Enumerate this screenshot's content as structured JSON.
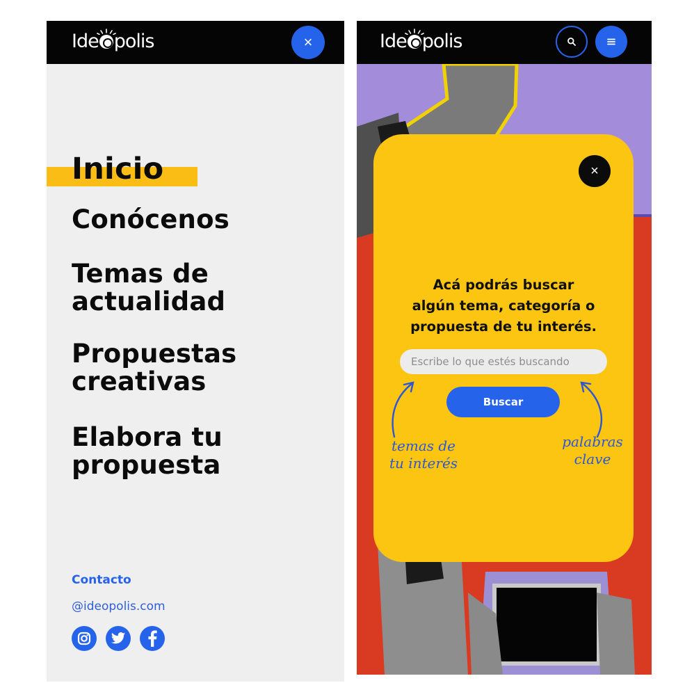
{
  "brand": {
    "logo_text_before": "Ide",
    "logo_text_after": "polis"
  },
  "colors": {
    "accent": "#2563eb",
    "highlight": "#f9bd15",
    "card": "#fbc512",
    "header": "#050505",
    "background_red": "#d93a22",
    "background_purple": "#a38ddb"
  },
  "menu_screen": {
    "close_icon": "×",
    "items": [
      {
        "label": "Inicio",
        "active": true
      },
      {
        "label": "Conócenos"
      },
      {
        "label": "Temas de",
        "label_line2": "actualidad"
      },
      {
        "label": "Propuestas",
        "label_line2": "creativas"
      },
      {
        "label": "Elabora tu",
        "label_line2": "propuesta"
      }
    ],
    "contact": {
      "title": "Contacto",
      "email": "@ideopolis.com",
      "social": [
        "instagram-icon",
        "twitter-icon",
        "facebook-icon"
      ]
    }
  },
  "search_screen": {
    "search_icon": "⌕",
    "menu_icon": "≡",
    "close_icon": "×",
    "message_line1": "Acá podrás buscar",
    "message_line2": "algún tema, categoría o",
    "message_line3": "propuesta de tu interés.",
    "input_placeholder": "Escribe lo que estés buscando",
    "button_label": "Buscar",
    "note_left_line1": "temas de",
    "note_left_line2": "tu interés",
    "note_right_line1": "palabras",
    "note_right_line2": "clave"
  }
}
